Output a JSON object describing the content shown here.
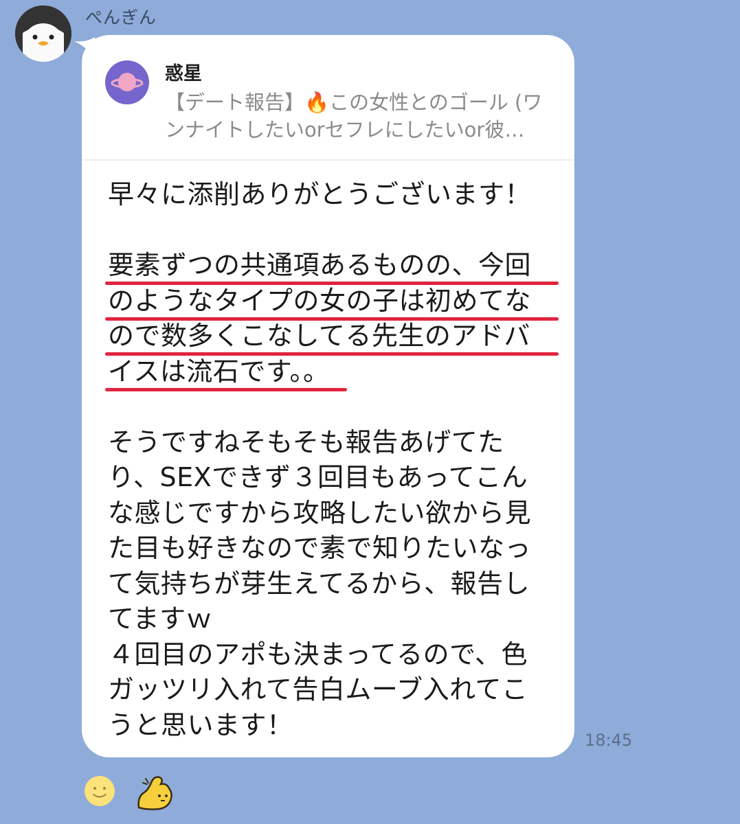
{
  "sender": {
    "name": "ぺんぎん",
    "avatar_icon": "penguin-icon"
  },
  "quoted_message": {
    "author": "惑星",
    "avatar_icon": "planet-icon",
    "text": "【デート報告】🔥この女性とのゴール (ワンナイトしたいorセフレにしたいor彼…"
  },
  "message": {
    "lines": [
      "早々に添削ありがとうございます！",
      "",
      "要素ずつの共通項あるものの、今回",
      "のようなタイプの女の子は初めてな",
      "ので数多くこなしてる先生のアドバ",
      "イスは流石です。。",
      "",
      "そうですねそもそも報告あげてた",
      "り、SEXできず３回目もあってこん",
      "な感じですから攻略したい欲から見",
      "た目も好きなので素で知りたいなっ",
      "て気持ちが芽生えてるから、報告し",
      "てますｗ",
      "４回目のアポも決まってるので、色",
      "ガッツリ入れて告白ムーブ入れてこ",
      "うと思います！"
    ]
  },
  "timestamp": "18:45",
  "reactions": [
    {
      "icon": "smiley-face-icon"
    },
    {
      "icon": "flexing-arm-icon"
    }
  ],
  "colors": {
    "background": "#8eabd9",
    "bubble": "#ffffff",
    "underline": "#e0243f",
    "quote_text": "#8a8a8a"
  }
}
